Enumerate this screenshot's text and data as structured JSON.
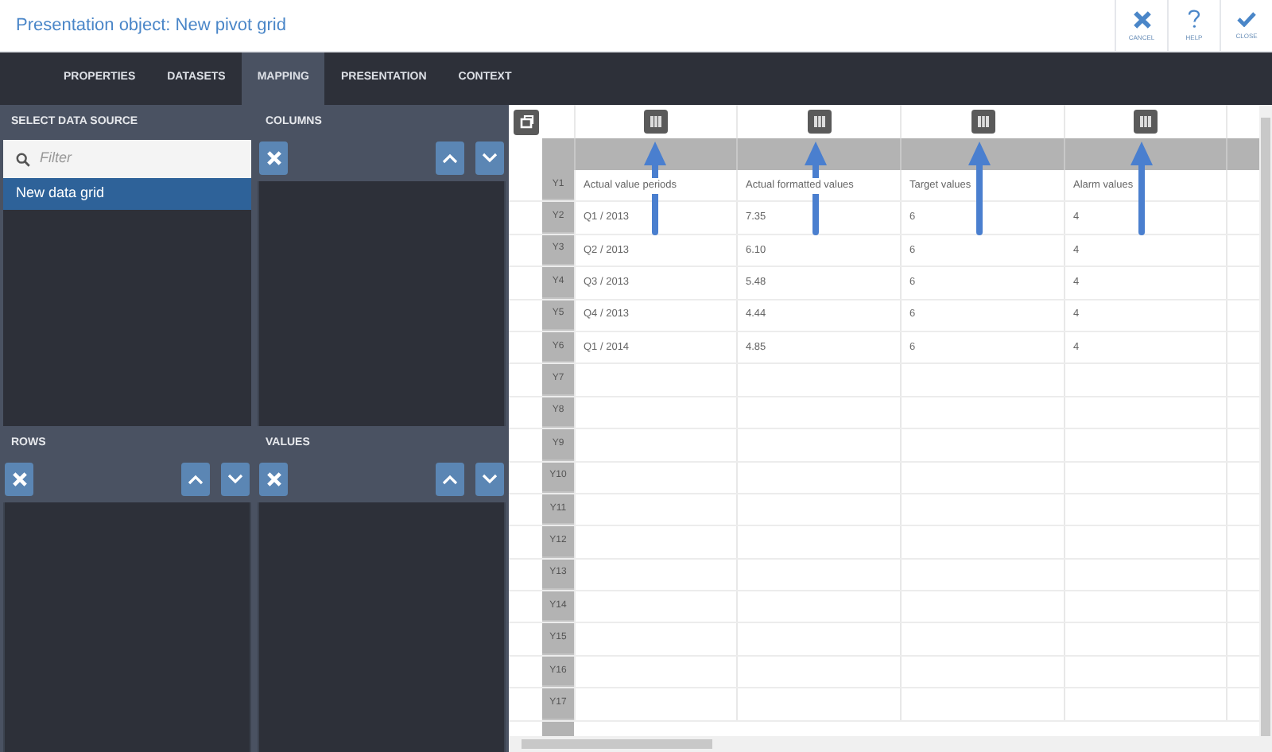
{
  "window": {
    "title": "Presentation object: New pivot grid"
  },
  "header_buttons": [
    {
      "kind": "cancel",
      "label": "CANCEL"
    },
    {
      "kind": "help",
      "label": "HELP"
    },
    {
      "kind": "close",
      "label": "CLOSE"
    }
  ],
  "tabs": [
    {
      "label": "PROPERTIES",
      "selected": false
    },
    {
      "label": "DATASETS",
      "selected": false
    },
    {
      "label": "MAPPING",
      "selected": true
    },
    {
      "label": "PRESENTATION",
      "selected": false
    },
    {
      "label": "CONTEXT",
      "selected": false
    }
  ],
  "data_source": {
    "title": "SELECT DATA SOURCE",
    "filter": {
      "placeholder": "Filter"
    },
    "items": [
      {
        "label": "New data grid",
        "selected": true
      }
    ]
  },
  "columns_panel": {
    "title": "COLUMNS"
  },
  "rows_panel": {
    "title": "ROWS"
  },
  "values_panel": {
    "title": "VALUES"
  },
  "grid": {
    "rows": [
      {
        "header": "Y1",
        "cells": [
          "Actual value periods",
          "Actual formatted values",
          "Target values",
          "Alarm values"
        ]
      },
      {
        "header": "Y2",
        "cells": [
          "Q1 / 2013",
          "7.35",
          "6",
          "4"
        ]
      },
      {
        "header": "Y3",
        "cells": [
          "Q2 / 2013",
          "6.10",
          "6",
          "4"
        ]
      },
      {
        "header": "Y4",
        "cells": [
          "Q3 / 2013",
          "5.48",
          "6",
          "4"
        ]
      },
      {
        "header": "Y5",
        "cells": [
          "Q4 / 2013",
          "4.44",
          "6",
          "4"
        ]
      },
      {
        "header": "Y6",
        "cells": [
          "Q1 / 2014",
          "4.85",
          "6",
          "4"
        ]
      },
      {
        "header": "Y7"
      },
      {
        "header": "Y8"
      },
      {
        "header": "Y9"
      },
      {
        "header": "Y10"
      },
      {
        "header": "Y11"
      },
      {
        "header": "Y12"
      },
      {
        "header": "Y13"
      },
      {
        "header": "Y14"
      },
      {
        "header": "Y15"
      },
      {
        "header": "Y16"
      },
      {
        "header": "Y17"
      }
    ]
  }
}
